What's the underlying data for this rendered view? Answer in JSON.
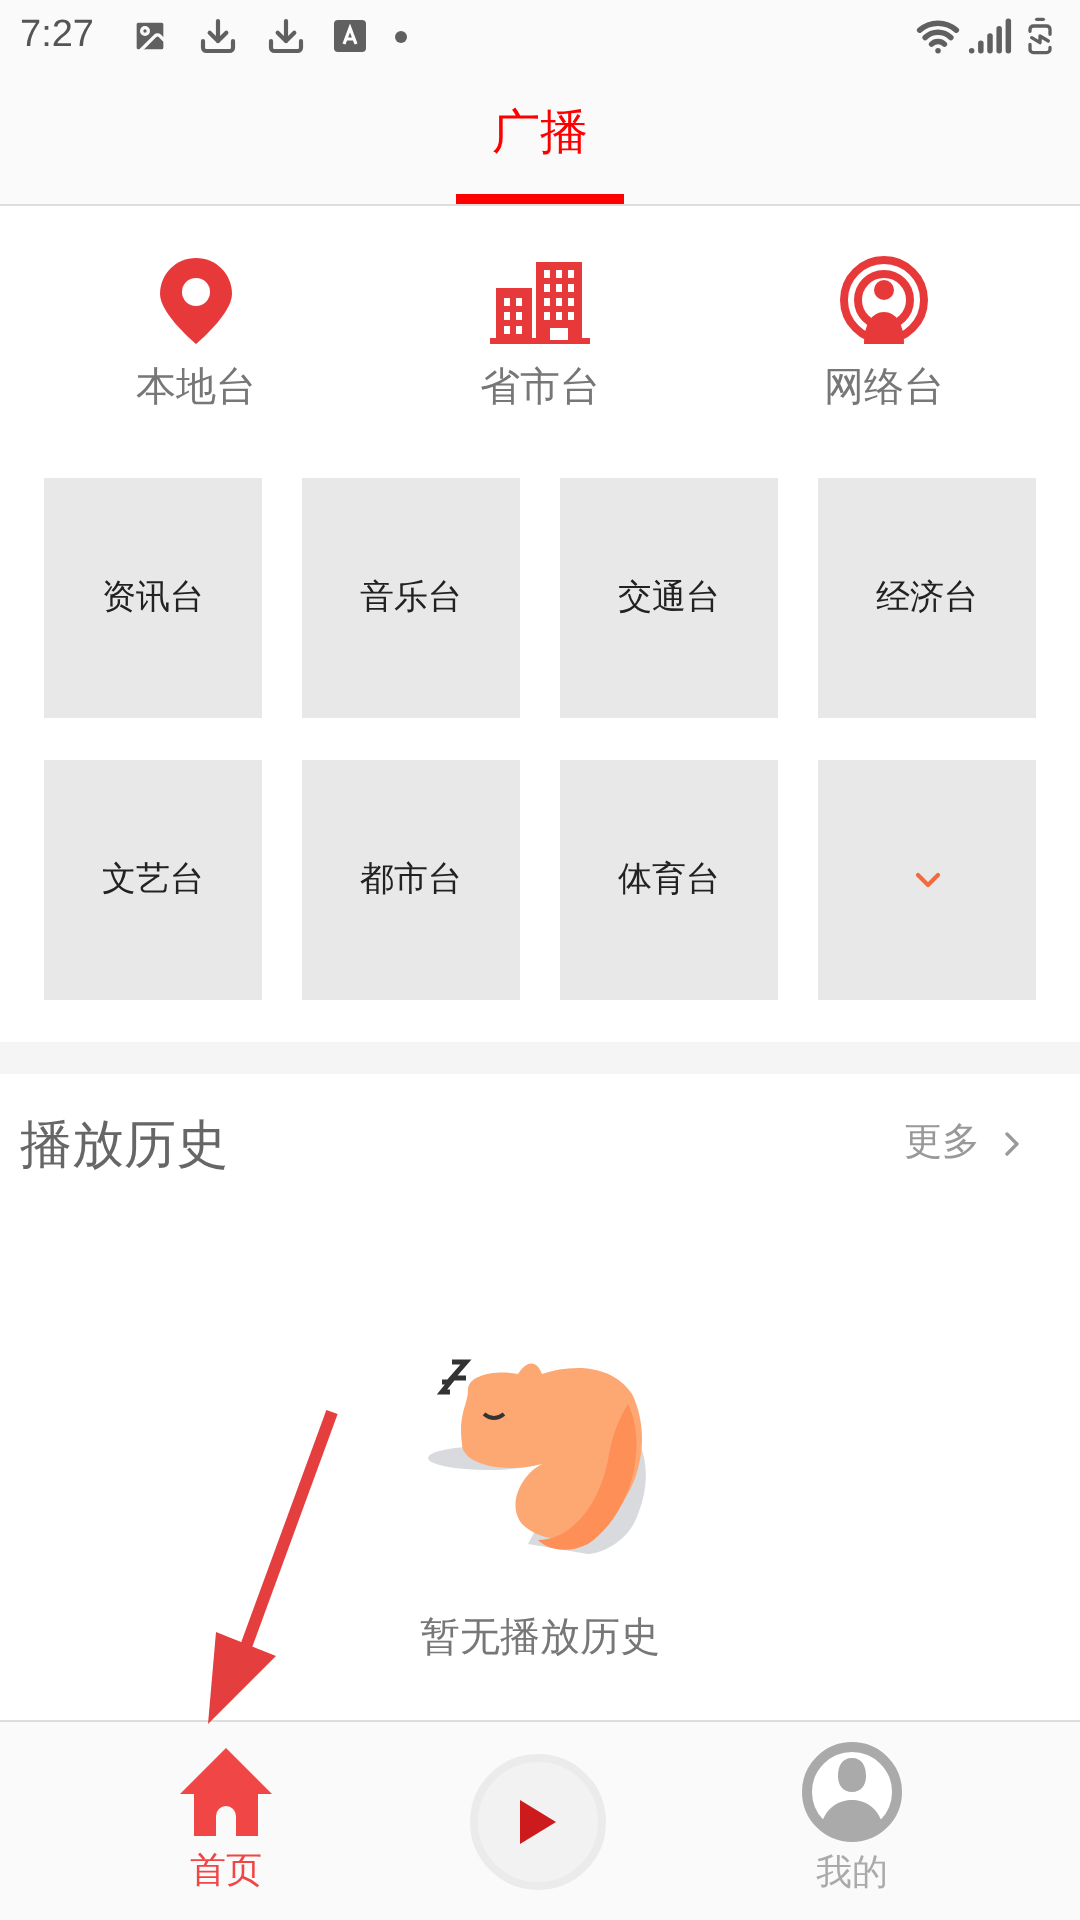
{
  "status_bar": {
    "time": "7:27"
  },
  "tabs": [
    {
      "label": "广播",
      "selected": true
    }
  ],
  "categories": [
    {
      "label": "本地台",
      "kind": "pin"
    },
    {
      "label": "省市台",
      "kind": "building"
    },
    {
      "label": "网络台",
      "kind": "broadcast"
    }
  ],
  "tiles": [
    {
      "kind": "label",
      "label": "资讯台"
    },
    {
      "kind": "label",
      "label": "音乐台"
    },
    {
      "kind": "label",
      "label": "交通台"
    },
    {
      "kind": "label",
      "label": "经济台"
    },
    {
      "kind": "label",
      "label": "文艺台"
    },
    {
      "kind": "label",
      "label": "都市台"
    },
    {
      "kind": "label",
      "label": "体育台"
    },
    {
      "kind": "more"
    }
  ],
  "history": {
    "title": "播放历史",
    "more": "更多",
    "empty_text": "暂无播放历史"
  },
  "bottom_nav": [
    {
      "label": "首页",
      "kind": "home",
      "selected": true
    },
    {
      "kind": "play"
    },
    {
      "label": "我的",
      "kind": "user",
      "selected": false
    }
  ]
}
